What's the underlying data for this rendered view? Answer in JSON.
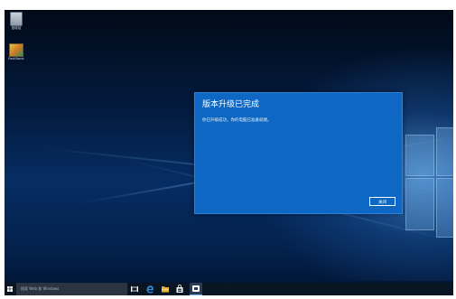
{
  "desktop": {
    "icons": [
      {
        "label": "回收站",
        "icon": "recycle-bin-icon"
      },
      {
        "label": "FastStone",
        "icon": "faststone-icon"
      }
    ]
  },
  "dialog": {
    "title": "版本升级已完成",
    "message": "你已升级成功，你的电脑已准备就绪。",
    "close_label": "关闭",
    "background": "#0e67c2"
  },
  "taskbar": {
    "search_placeholder": "搜索 Web 和 Windows",
    "icons": [
      "windows-start-icon",
      "task-view-icon",
      "edge-icon",
      "file-explorer-icon",
      "store-icon",
      "active-app-icon"
    ]
  }
}
